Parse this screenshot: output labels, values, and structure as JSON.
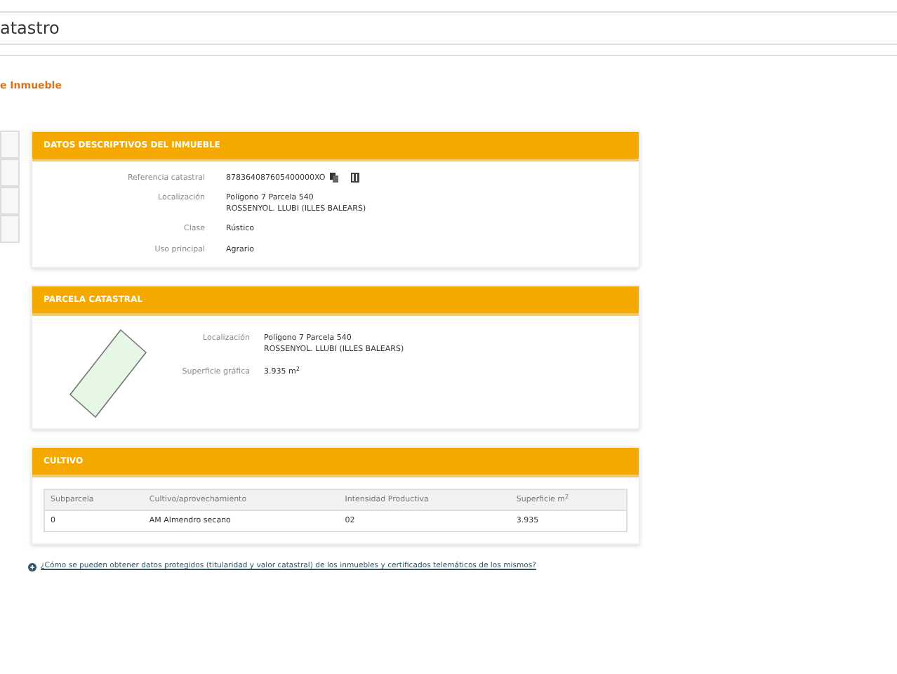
{
  "header": {
    "title": "atastro"
  },
  "page_title": "e Inmueble",
  "datos": {
    "title": "DATOS DESCRIPTIVOS DEL INMUEBLE",
    "rows": [
      {
        "label": "Referencia catastral",
        "lines": [
          "878364087605400000XO"
        ],
        "kind": "ref"
      },
      {
        "label": "Localización",
        "lines": [
          "Polígono 7 Parcela 540",
          "ROSSENYOL. LLUBI (ILLES BALEARS)"
        ],
        "kind": "text"
      },
      {
        "label": "Clase",
        "lines": [
          "Rústico"
        ],
        "kind": "text"
      },
      {
        "label": "Uso principal",
        "lines": [
          "Agrario"
        ],
        "kind": "text"
      }
    ]
  },
  "parcela": {
    "title": "PARCELA CATASTRAL",
    "rows": [
      {
        "label": "Localización",
        "lines": [
          "Polígono 7 Parcela 540",
          "ROSSENYOL. LLUBI (ILLES BALEARS)"
        ]
      },
      {
        "label": "Superficie gráfica",
        "lines": [
          "3.935 m$^{2}$"
        ]
      }
    ]
  },
  "cultivo": {
    "title": "CULTIVO",
    "columns": [
      "Subparcela",
      "Cultivo/aprovechamiento",
      "Intensidad Productiva",
      "Superficie m$^{2}$"
    ],
    "rows": [
      [
        "0",
        "AM Almendro secano",
        "02",
        "3.935"
      ]
    ]
  },
  "link": "¿Cómo se pueden obtener datos protegidos (titularidad y valor catastral) de los inmuebles y certificados telemáticos de los mismos?"
}
